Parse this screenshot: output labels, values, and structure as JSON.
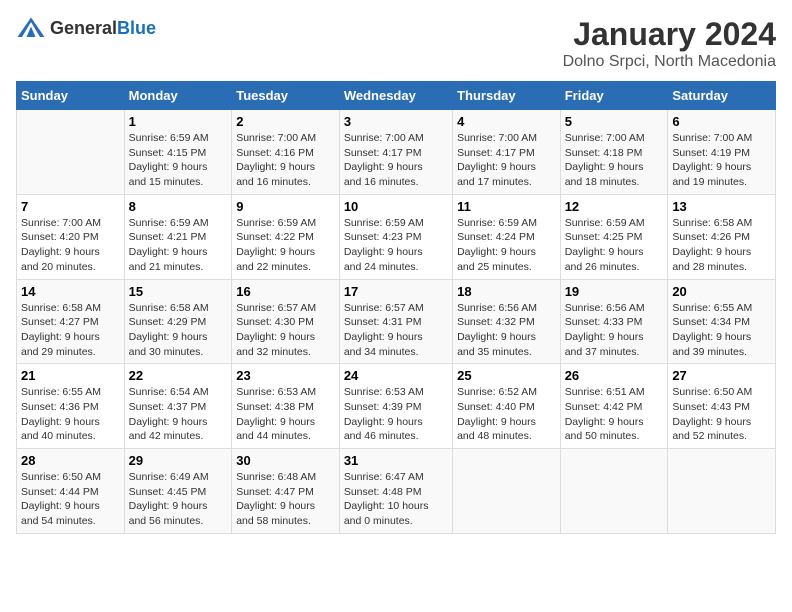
{
  "header": {
    "logo_general": "General",
    "logo_blue": "Blue",
    "title": "January 2024",
    "subtitle": "Dolno Srpci, North Macedonia"
  },
  "calendar": {
    "days_of_week": [
      "Sunday",
      "Monday",
      "Tuesday",
      "Wednesday",
      "Thursday",
      "Friday",
      "Saturday"
    ],
    "weeks": [
      [
        {
          "day": "",
          "info": ""
        },
        {
          "day": "1",
          "info": "Sunrise: 6:59 AM\nSunset: 4:15 PM\nDaylight: 9 hours\nand 15 minutes."
        },
        {
          "day": "2",
          "info": "Sunrise: 7:00 AM\nSunset: 4:16 PM\nDaylight: 9 hours\nand 16 minutes."
        },
        {
          "day": "3",
          "info": "Sunrise: 7:00 AM\nSunset: 4:17 PM\nDaylight: 9 hours\nand 16 minutes."
        },
        {
          "day": "4",
          "info": "Sunrise: 7:00 AM\nSunset: 4:17 PM\nDaylight: 9 hours\nand 17 minutes."
        },
        {
          "day": "5",
          "info": "Sunrise: 7:00 AM\nSunset: 4:18 PM\nDaylight: 9 hours\nand 18 minutes."
        },
        {
          "day": "6",
          "info": "Sunrise: 7:00 AM\nSunset: 4:19 PM\nDaylight: 9 hours\nand 19 minutes."
        }
      ],
      [
        {
          "day": "7",
          "info": "Sunrise: 7:00 AM\nSunset: 4:20 PM\nDaylight: 9 hours\nand 20 minutes."
        },
        {
          "day": "8",
          "info": "Sunrise: 6:59 AM\nSunset: 4:21 PM\nDaylight: 9 hours\nand 21 minutes."
        },
        {
          "day": "9",
          "info": "Sunrise: 6:59 AM\nSunset: 4:22 PM\nDaylight: 9 hours\nand 22 minutes."
        },
        {
          "day": "10",
          "info": "Sunrise: 6:59 AM\nSunset: 4:23 PM\nDaylight: 9 hours\nand 24 minutes."
        },
        {
          "day": "11",
          "info": "Sunrise: 6:59 AM\nSunset: 4:24 PM\nDaylight: 9 hours\nand 25 minutes."
        },
        {
          "day": "12",
          "info": "Sunrise: 6:59 AM\nSunset: 4:25 PM\nDaylight: 9 hours\nand 26 minutes."
        },
        {
          "day": "13",
          "info": "Sunrise: 6:58 AM\nSunset: 4:26 PM\nDaylight: 9 hours\nand 28 minutes."
        }
      ],
      [
        {
          "day": "14",
          "info": "Sunrise: 6:58 AM\nSunset: 4:27 PM\nDaylight: 9 hours\nand 29 minutes."
        },
        {
          "day": "15",
          "info": "Sunrise: 6:58 AM\nSunset: 4:29 PM\nDaylight: 9 hours\nand 30 minutes."
        },
        {
          "day": "16",
          "info": "Sunrise: 6:57 AM\nSunset: 4:30 PM\nDaylight: 9 hours\nand 32 minutes."
        },
        {
          "day": "17",
          "info": "Sunrise: 6:57 AM\nSunset: 4:31 PM\nDaylight: 9 hours\nand 34 minutes."
        },
        {
          "day": "18",
          "info": "Sunrise: 6:56 AM\nSunset: 4:32 PM\nDaylight: 9 hours\nand 35 minutes."
        },
        {
          "day": "19",
          "info": "Sunrise: 6:56 AM\nSunset: 4:33 PM\nDaylight: 9 hours\nand 37 minutes."
        },
        {
          "day": "20",
          "info": "Sunrise: 6:55 AM\nSunset: 4:34 PM\nDaylight: 9 hours\nand 39 minutes."
        }
      ],
      [
        {
          "day": "21",
          "info": "Sunrise: 6:55 AM\nSunset: 4:36 PM\nDaylight: 9 hours\nand 40 minutes."
        },
        {
          "day": "22",
          "info": "Sunrise: 6:54 AM\nSunset: 4:37 PM\nDaylight: 9 hours\nand 42 minutes."
        },
        {
          "day": "23",
          "info": "Sunrise: 6:53 AM\nSunset: 4:38 PM\nDaylight: 9 hours\nand 44 minutes."
        },
        {
          "day": "24",
          "info": "Sunrise: 6:53 AM\nSunset: 4:39 PM\nDaylight: 9 hours\nand 46 minutes."
        },
        {
          "day": "25",
          "info": "Sunrise: 6:52 AM\nSunset: 4:40 PM\nDaylight: 9 hours\nand 48 minutes."
        },
        {
          "day": "26",
          "info": "Sunrise: 6:51 AM\nSunset: 4:42 PM\nDaylight: 9 hours\nand 50 minutes."
        },
        {
          "day": "27",
          "info": "Sunrise: 6:50 AM\nSunset: 4:43 PM\nDaylight: 9 hours\nand 52 minutes."
        }
      ],
      [
        {
          "day": "28",
          "info": "Sunrise: 6:50 AM\nSunset: 4:44 PM\nDaylight: 9 hours\nand 54 minutes."
        },
        {
          "day": "29",
          "info": "Sunrise: 6:49 AM\nSunset: 4:45 PM\nDaylight: 9 hours\nand 56 minutes."
        },
        {
          "day": "30",
          "info": "Sunrise: 6:48 AM\nSunset: 4:47 PM\nDaylight: 9 hours\nand 58 minutes."
        },
        {
          "day": "31",
          "info": "Sunrise: 6:47 AM\nSunset: 4:48 PM\nDaylight: 10 hours\nand 0 minutes."
        },
        {
          "day": "",
          "info": ""
        },
        {
          "day": "",
          "info": ""
        },
        {
          "day": "",
          "info": ""
        }
      ]
    ]
  }
}
